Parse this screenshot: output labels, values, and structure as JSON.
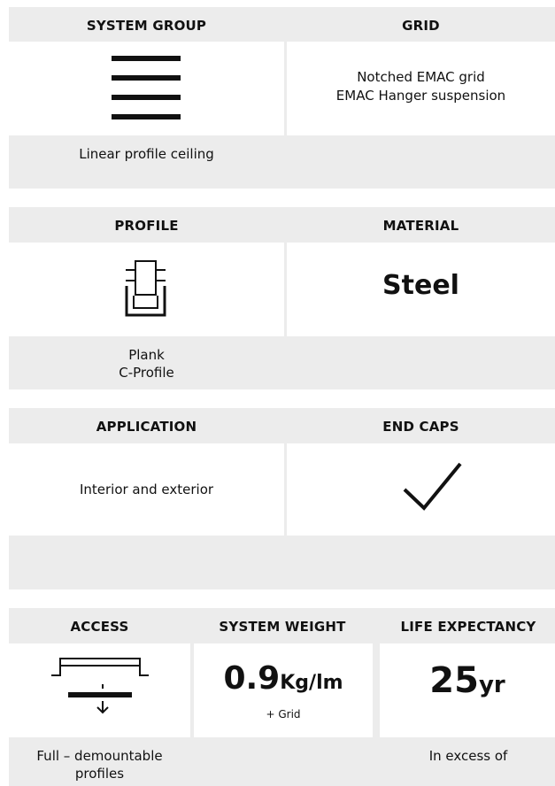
{
  "panel1": {
    "header_left": "SYSTEM GROUP",
    "header_right": "GRID",
    "icon": "linear-lines-icon",
    "right_text_1": "Notched EMAC grid",
    "right_text_2": "EMAC Hanger suspension",
    "caption_left": "Linear profile ceiling"
  },
  "panel2": {
    "header_left": "PROFILE",
    "header_right": "MATERIAL",
    "icon": "c-profile-icon",
    "material_value": "Steel",
    "caption_line1": "Plank",
    "caption_line2": "C-Profile"
  },
  "panel3": {
    "header_left": "APPLICATION",
    "header_right": "END CAPS",
    "left_text": "Interior and exterior",
    "icon": "checkmark-icon"
  },
  "panel4": {
    "header_1": "ACCESS",
    "header_2": "SYSTEM WEIGHT",
    "header_3": "LIFE EXPECTANCY",
    "icon": "access-down-arrow-icon",
    "weight_value": "0.9",
    "weight_unit": "Kg/lm",
    "weight_note": "+ Grid",
    "life_value": "25",
    "life_unit": "yr",
    "caption_1_line1": "Full – demountable",
    "caption_1_line2": "profiles",
    "caption_3": "In excess of"
  }
}
